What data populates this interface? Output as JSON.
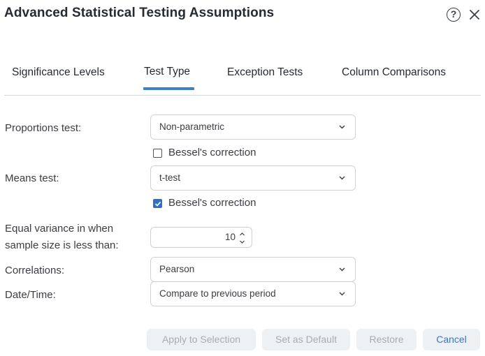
{
  "dialog": {
    "title": "Advanced Statistical Testing Assumptions",
    "help_icon": "?"
  },
  "tabs": [
    {
      "label": "Significance Levels",
      "active": false
    },
    {
      "label": "Test Type",
      "active": true
    },
    {
      "label": "Exception Tests",
      "active": false
    },
    {
      "label": "Column Comparisons",
      "active": false
    }
  ],
  "form": {
    "proportions": {
      "label": "Proportions test:",
      "value": "Non-parametric",
      "bessel_label": "Bessel's correction",
      "bessel_checked": false
    },
    "means": {
      "label": "Means test:",
      "value": "t-test",
      "bessel_label": "Bessel's correction",
      "bessel_checked": true
    },
    "equal_variance": {
      "label_line1": "Equal variance in when",
      "label_line2": "sample size is less than:",
      "value": "10"
    },
    "correlations": {
      "label": "Correlations:",
      "value": "Pearson"
    },
    "datetime": {
      "label": "Date/Time:",
      "value": "Compare to previous period"
    }
  },
  "footer": {
    "apply_label": "Apply to Selection",
    "default_label": "Set as Default",
    "restore_label": "Restore",
    "cancel_label": "Cancel"
  },
  "colors": {
    "accent": "#3f7fc7",
    "checkbox_checked": "#2f6fc4",
    "button_bg": "#eef1f4",
    "disabled_text": "#a7adb4"
  }
}
